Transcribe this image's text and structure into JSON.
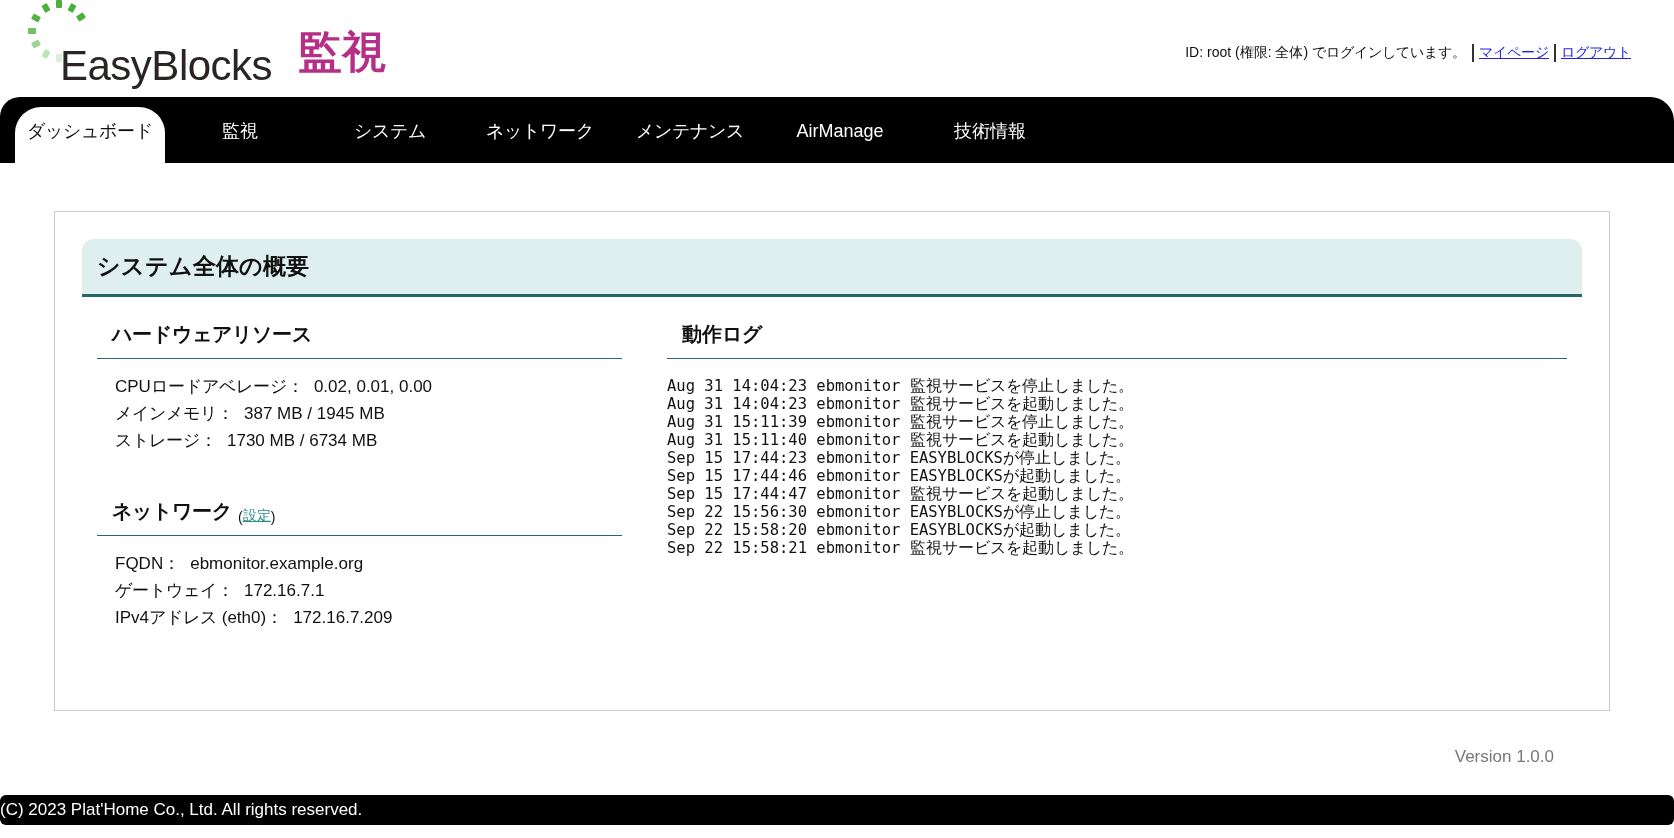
{
  "header": {
    "logo_text": "EasyBlocks",
    "logo_subtitle": "監視",
    "login_text": "ID: root (権限: 全体) でログインしています。",
    "links": [
      "マイページ",
      "ログアウト"
    ]
  },
  "tabs": [
    {
      "label": "ダッシュボード",
      "selected": true
    },
    {
      "label": "監視",
      "selected": false
    },
    {
      "label": "システム",
      "selected": false
    },
    {
      "label": "ネットワーク",
      "selected": false
    },
    {
      "label": "メンテナンス",
      "selected": false
    },
    {
      "label": "AirManage",
      "selected": false
    },
    {
      "label": "技術情報",
      "selected": false
    }
  ],
  "panel": {
    "title": "システム全体の概要",
    "hardware": {
      "title": "ハードウェアリソース",
      "items": [
        {
          "label": "CPUロードアベレージ：",
          "value": "0.02, 0.01, 0.00"
        },
        {
          "label": "メインメモリ：",
          "value": "387 MB / 1945 MB"
        },
        {
          "label": "ストレージ：",
          "value": "1730 MB / 6734 MB"
        }
      ]
    },
    "network": {
      "title": "ネットワーク",
      "paren_open": "(",
      "link": "設定",
      "paren_close": ")",
      "items": [
        {
          "label": "FQDN：",
          "value": "ebmonitor.example.org"
        },
        {
          "label": "ゲートウェイ：",
          "value": "172.16.7.1"
        },
        {
          "label": "IPv4アドレス (eth0)：",
          "value": "172.16.7.209"
        }
      ]
    },
    "log": {
      "title": "動作ログ",
      "lines": [
        "Aug 31 14:04:23 ebmonitor 監視サービスを停止しました。",
        "Aug 31 14:04:23 ebmonitor 監視サービスを起動しました。",
        "Aug 31 15:11:39 ebmonitor 監視サービスを停止しました。",
        "Aug 31 15:11:40 ebmonitor 監視サービスを起動しました。",
        "Sep 15 17:44:23 ebmonitor EASYBLOCKSが停止しました。",
        "Sep 15 17:44:46 ebmonitor EASYBLOCKSが起動しました。",
        "Sep 15 17:44:47 ebmonitor 監視サービスを起動しました。",
        "Sep 22 15:56:30 ebmonitor EASYBLOCKSが停止しました。",
        "Sep 22 15:58:20 ebmonitor EASYBLOCKSが起動しました。",
        "Sep 22 15:58:21 ebmonitor 監視サービスを起動しました。"
      ]
    }
  },
  "version": "Version 1.0.0",
  "footer": "(C) 2023 Plat'Home Co., Ltd. All rights reserved."
}
